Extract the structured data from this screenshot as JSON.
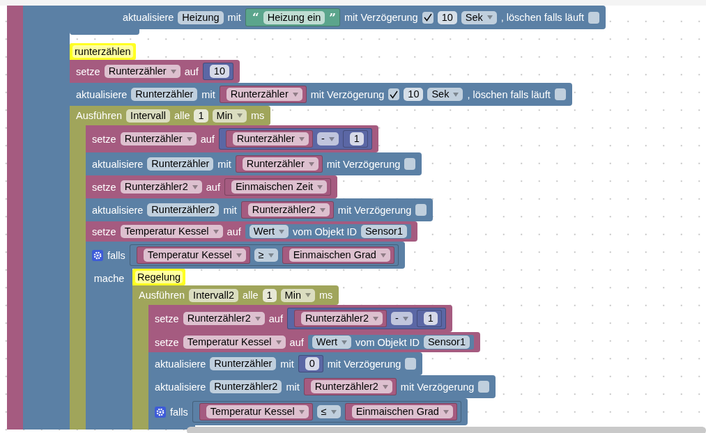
{
  "workspace": {
    "blocks": [
      {
        "kind": "function",
        "children": [
          {
            "kind": "falls",
            "children": [
              {
                "kind": "falls",
                "ends": true,
                "children": [
                  {
                    "kind": "aktualisiere",
                    "parts": [
                      {
                        "kind": "text",
                        "text": "aktualisiere"
                      },
                      {
                        "kind": "field",
                        "text": "Heizung"
                      },
                      {
                        "kind": "text",
                        "text": "mit"
                      },
                      {
                        "kind": "text_value",
                        "parts": [
                          {
                            "kind": "quote",
                            "text": "“"
                          },
                          {
                            "kind": "field",
                            "text": "Heizung ein"
                          },
                          {
                            "kind": "quote",
                            "text": "”"
                          }
                        ]
                      },
                      {
                        "kind": "text",
                        "text": "mit Verzögerung"
                      },
                      {
                        "kind": "checkbox",
                        "checked": true
                      },
                      {
                        "kind": "number",
                        "text": "10"
                      },
                      {
                        "kind": "dropdown",
                        "text": "Sek"
                      },
                      {
                        "kind": "text",
                        "text": ", löschen falls läuft"
                      },
                      {
                        "kind": "checkbox",
                        "checked": false
                      }
                    ]
                  }
                ]
              },
              {
                "kind": "setze",
                "comment": "runterzählen",
                "parts": [
                  {
                    "kind": "text",
                    "text": "setze"
                  },
                  {
                    "kind": "dropdown",
                    "text": "Runterzähler"
                  },
                  {
                    "kind": "text",
                    "text": "auf"
                  },
                  {
                    "kind": "number_value",
                    "parts": [
                      {
                        "kind": "number",
                        "text": "10"
                      }
                    ]
                  }
                ]
              },
              {
                "kind": "aktualisiere",
                "parts": [
                  {
                    "kind": "text",
                    "text": "aktualisiere"
                  },
                  {
                    "kind": "field",
                    "text": "Runterzähler"
                  },
                  {
                    "kind": "text",
                    "text": "mit"
                  },
                  {
                    "kind": "variable",
                    "parts": [
                      {
                        "kind": "dropdown",
                        "text": "Runterzähler"
                      }
                    ]
                  },
                  {
                    "kind": "text",
                    "text": "mit Verzögerung"
                  },
                  {
                    "kind": "checkbox",
                    "checked": true
                  },
                  {
                    "kind": "number",
                    "text": "10"
                  },
                  {
                    "kind": "dropdown",
                    "text": "Sek"
                  },
                  {
                    "kind": "text",
                    "text": ", löschen falls läuft"
                  },
                  {
                    "kind": "checkbox",
                    "checked": false
                  }
                ]
              },
              {
                "kind": "ausfuehren",
                "parts": [
                  {
                    "kind": "text",
                    "text": "Ausführen"
                  },
                  {
                    "kind": "field",
                    "text": "Intervall"
                  },
                  {
                    "kind": "text",
                    "text": "alle"
                  },
                  {
                    "kind": "number",
                    "text": "1"
                  },
                  {
                    "kind": "dropdown",
                    "text": "Min"
                  },
                  {
                    "kind": "text",
                    "text": "ms"
                  }
                ],
                "children": [
                  {
                    "kind": "setze",
                    "parts": [
                      {
                        "kind": "text",
                        "text": "setze"
                      },
                      {
                        "kind": "dropdown",
                        "text": "Runterzähler"
                      },
                      {
                        "kind": "text",
                        "text": "auf"
                      },
                      {
                        "kind": "math",
                        "parts": [
                          {
                            "kind": "variable",
                            "parts": [
                              {
                                "kind": "dropdown",
                                "text": "Runterzähler"
                              }
                            ]
                          },
                          {
                            "kind": "dropdown",
                            "text": "-"
                          },
                          {
                            "kind": "number_value",
                            "parts": [
                              {
                                "kind": "number",
                                "text": "1"
                              }
                            ]
                          }
                        ]
                      }
                    ]
                  },
                  {
                    "kind": "aktualisiere",
                    "parts": [
                      {
                        "kind": "text",
                        "text": "aktualisiere"
                      },
                      {
                        "kind": "field",
                        "text": "Runterzähler"
                      },
                      {
                        "kind": "text",
                        "text": "mit"
                      },
                      {
                        "kind": "variable",
                        "parts": [
                          {
                            "kind": "dropdown",
                            "text": "Runterzähler"
                          }
                        ]
                      },
                      {
                        "kind": "text",
                        "text": "mit Verzögerung"
                      },
                      {
                        "kind": "checkbox",
                        "checked": false
                      }
                    ]
                  },
                  {
                    "kind": "setze",
                    "parts": [
                      {
                        "kind": "text",
                        "text": "setze"
                      },
                      {
                        "kind": "dropdown",
                        "text": "Runterzähler2"
                      },
                      {
                        "kind": "text",
                        "text": "auf"
                      },
                      {
                        "kind": "variable",
                        "parts": [
                          {
                            "kind": "dropdown",
                            "text": "Einmaischen Zeit"
                          }
                        ]
                      }
                    ]
                  },
                  {
                    "kind": "aktualisiere",
                    "parts": [
                      {
                        "kind": "text",
                        "text": "aktualisiere"
                      },
                      {
                        "kind": "field",
                        "text": "Runterzähler2"
                      },
                      {
                        "kind": "text",
                        "text": "mit"
                      },
                      {
                        "kind": "variable",
                        "parts": [
                          {
                            "kind": "dropdown",
                            "text": "Runterzähler2"
                          }
                        ]
                      },
                      {
                        "kind": "text",
                        "text": "mit Verzögerung"
                      },
                      {
                        "kind": "checkbox",
                        "checked": false
                      }
                    ]
                  },
                  {
                    "kind": "setze",
                    "parts": [
                      {
                        "kind": "text",
                        "text": "setze"
                      },
                      {
                        "kind": "dropdown",
                        "text": "Temperatur Kessel"
                      },
                      {
                        "kind": "text",
                        "text": "auf"
                      },
                      {
                        "kind": "object",
                        "parts": [
                          {
                            "kind": "dropdown",
                            "text": "Wert"
                          },
                          {
                            "kind": "text",
                            "text": "vom Objekt ID"
                          },
                          {
                            "kind": "field",
                            "text": "Sensor1"
                          }
                        ]
                      }
                    ]
                  },
                  {
                    "kind": "falls",
                    "arm_label": "mache",
                    "parts": [
                      {
                        "kind": "gear"
                      },
                      {
                        "kind": "text",
                        "text": "falls"
                      },
                      {
                        "kind": "compare",
                        "parts": [
                          {
                            "kind": "variable",
                            "parts": [
                              {
                                "kind": "dropdown",
                                "text": "Temperatur Kessel"
                              }
                            ]
                          },
                          {
                            "kind": "dropdown",
                            "text": "≥"
                          },
                          {
                            "kind": "variable",
                            "parts": [
                              {
                                "kind": "dropdown",
                                "text": "Einmaischen Grad"
                              }
                            ]
                          }
                        ]
                      }
                    ],
                    "children": [
                      {
                        "kind": "ausfuehren",
                        "comment": "Regelung",
                        "parts": [
                          {
                            "kind": "text",
                            "text": "Ausführen"
                          },
                          {
                            "kind": "field",
                            "text": "Intervall2"
                          },
                          {
                            "kind": "text",
                            "text": "alle"
                          },
                          {
                            "kind": "number",
                            "text": "1"
                          },
                          {
                            "kind": "dropdown",
                            "text": "Min"
                          },
                          {
                            "kind": "text",
                            "text": "ms"
                          }
                        ],
                        "children": [
                          {
                            "kind": "setze",
                            "parts": [
                              {
                                "kind": "text",
                                "text": "setze"
                              },
                              {
                                "kind": "dropdown",
                                "text": "Runterzähler2"
                              },
                              {
                                "kind": "text",
                                "text": "auf"
                              },
                              {
                                "kind": "math",
                                "parts": [
                                  {
                                    "kind": "variable",
                                    "parts": [
                                      {
                                        "kind": "dropdown",
                                        "text": "Runterzähler2"
                                      }
                                    ]
                                  },
                                  {
                                    "kind": "dropdown",
                                    "text": "-"
                                  },
                                  {
                                    "kind": "number_value",
                                    "parts": [
                                      {
                                        "kind": "number",
                                        "text": "1"
                                      }
                                    ]
                                  }
                                ]
                              }
                            ]
                          },
                          {
                            "kind": "setze",
                            "parts": [
                              {
                                "kind": "text",
                                "text": "setze"
                              },
                              {
                                "kind": "dropdown",
                                "text": "Temperatur Kessel"
                              },
                              {
                                "kind": "text",
                                "text": "auf"
                              },
                              {
                                "kind": "object",
                                "parts": [
                                  {
                                    "kind": "dropdown",
                                    "text": "Wert"
                                  },
                                  {
                                    "kind": "text",
                                    "text": "vom Objekt ID"
                                  },
                                  {
                                    "kind": "field",
                                    "text": "Sensor1"
                                  }
                                ]
                              }
                            ]
                          },
                          {
                            "kind": "aktualisiere",
                            "parts": [
                              {
                                "kind": "text",
                                "text": "aktualisiere"
                              },
                              {
                                "kind": "field",
                                "text": "Runterzähler"
                              },
                              {
                                "kind": "text",
                                "text": "mit"
                              },
                              {
                                "kind": "number_value",
                                "parts": [
                                  {
                                    "kind": "number",
                                    "text": "0"
                                  }
                                ]
                              },
                              {
                                "kind": "text",
                                "text": "mit Verzögerung"
                              },
                              {
                                "kind": "checkbox",
                                "checked": false
                              }
                            ]
                          },
                          {
                            "kind": "aktualisiere",
                            "parts": [
                              {
                                "kind": "text",
                                "text": "aktualisiere"
                              },
                              {
                                "kind": "field",
                                "text": "Runterzähler2"
                              },
                              {
                                "kind": "text",
                                "text": "mit"
                              },
                              {
                                "kind": "variable",
                                "parts": [
                                  {
                                    "kind": "dropdown",
                                    "text": "Runterzähler2"
                                  }
                                ]
                              },
                              {
                                "kind": "text",
                                "text": "mit Verzögerung"
                              },
                              {
                                "kind": "checkbox",
                                "checked": false
                              }
                            ]
                          },
                          {
                            "kind": "falls",
                            "parts": [
                              {
                                "kind": "gear"
                              },
                              {
                                "kind": "text",
                                "text": "falls"
                              },
                              {
                                "kind": "compare",
                                "parts": [
                                  {
                                    "kind": "variable",
                                    "parts": [
                                      {
                                        "kind": "dropdown",
                                        "text": "Temperatur Kessel"
                                      }
                                    ]
                                  },
                                  {
                                    "kind": "dropdown",
                                    "text": "≤"
                                  },
                                  {
                                    "kind": "variable",
                                    "parts": [
                                      {
                                        "kind": "dropdown",
                                        "text": "Einmaischen Grad"
                                      }
                                    ]
                                  }
                                ]
                              }
                            ]
                          }
                        ]
                      }
                    ]
                  }
                ]
              }
            ]
          }
        ]
      }
    ]
  }
}
